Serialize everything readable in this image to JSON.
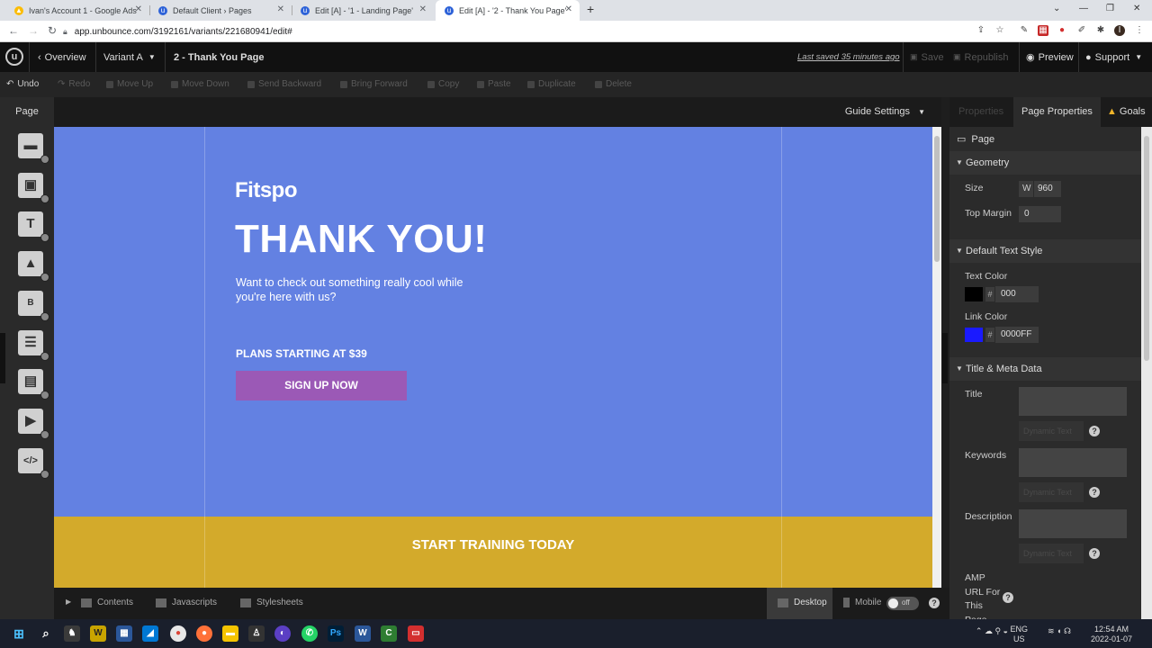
{
  "browser": {
    "tabs": [
      {
        "title": "Ivan's Account 1 - Google Ads",
        "icon": "google-ads-icon",
        "color": "#fbbc04"
      },
      {
        "title": "Default Client › Pages",
        "icon": "unbounce-icon",
        "color": "#2d62d8"
      },
      {
        "title": "Edit [A] - '1 - Landing Page'",
        "icon": "unbounce-icon",
        "color": "#2d62d8"
      },
      {
        "title": "Edit [A] - '2 - Thank You Page'",
        "icon": "unbounce-icon",
        "color": "#2d62d8"
      }
    ],
    "active_tab": 3,
    "url": "app.unbounce.com/3192161/variants/221680941/edit#"
  },
  "topbar": {
    "overview": "Overview",
    "variant": "Variant A",
    "page_name": "2 - Thank You Page",
    "last_saved": "Last saved 35 minutes ago",
    "save": "Save",
    "republish": "Republish",
    "preview": "Preview",
    "support": "Support"
  },
  "edit_tools": {
    "undo": "Undo",
    "redo": "Redo",
    "move_up": "Move Up",
    "move_down": "Move Down",
    "send_backward": "Send Backward",
    "bring_forward": "Bring Forward",
    "copy": "Copy",
    "paste": "Paste",
    "duplicate": "Duplicate",
    "delete": "Delete"
  },
  "left_palette": {
    "page_tab": "Page",
    "tools": [
      "section-icon",
      "box-icon",
      "text-icon",
      "image-icon",
      "button-icon",
      "form-icon",
      "lightbox-icon",
      "video-icon",
      "code-icon"
    ]
  },
  "canvas": {
    "guide_settings": "Guide Settings",
    "brand": "Fitspo",
    "heading": "THANK YOU!",
    "subtext": "Want to check out something really cool while you're here with us?",
    "plans": "PLANS STARTING AT $39",
    "cta": "SIGN UP NOW",
    "training": "START TRAINING TODAY",
    "hero_color": "#6381e2",
    "section_color": "#d3aa2b",
    "cta_color": "#9b59b6"
  },
  "bottom_bar": {
    "contents": "Contents",
    "javascripts": "Javascripts",
    "stylesheets": "Stylesheets",
    "desktop": "Desktop",
    "mobile": "Mobile",
    "toggle": "off"
  },
  "right_panel": {
    "tabs": {
      "properties": "Properties",
      "page_properties": "Page Properties",
      "goals": "Goals"
    },
    "page_label": "Page",
    "geometry": {
      "header": "Geometry",
      "size_label": "Size",
      "size_w_prefix": "W",
      "size_w": "960",
      "top_margin_label": "Top Margin",
      "top_margin": "0"
    },
    "text_style": {
      "header": "Default Text Style",
      "text_color_label": "Text Color",
      "text_color": "000",
      "text_color_hex": "#000000",
      "link_color_label": "Link Color",
      "link_color": "0000FF",
      "link_color_hex": "#1a1aff",
      "hash": "#"
    },
    "meta": {
      "header": "Title & Meta Data",
      "title_label": "Title",
      "keywords_label": "Keywords",
      "description_label": "Description",
      "amp_label": "AMP URL For This Page",
      "dynamic_text": "Dynamic Text"
    }
  },
  "taskbar": {
    "lang": "ENG",
    "region": "US",
    "time": "12:54 AM",
    "date": "2022-01-07"
  }
}
